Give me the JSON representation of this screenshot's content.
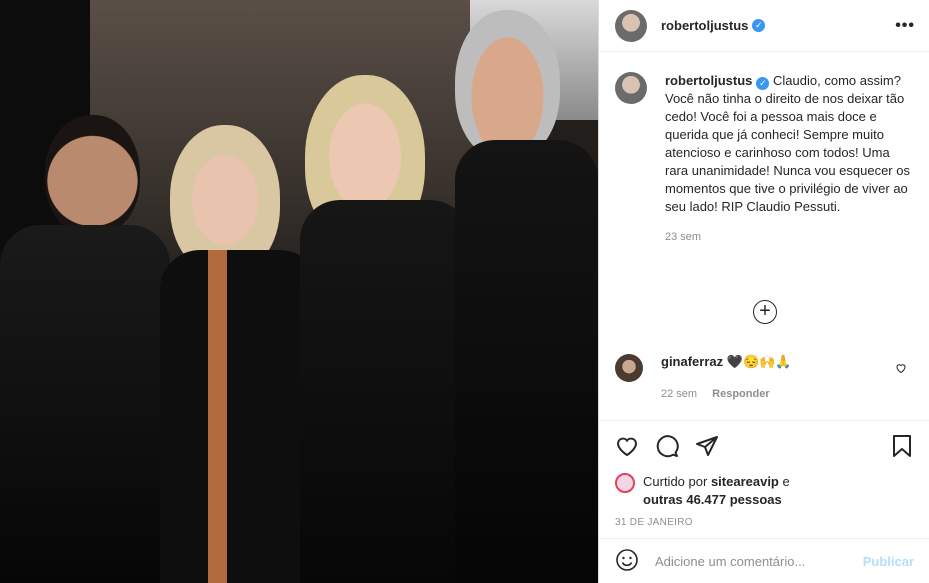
{
  "post": {
    "username": "robertoljustus",
    "more_icon": "more-dots-icon"
  },
  "caption": {
    "username": "robertoljustus",
    "text": "Claudio, como assim? Você não tinha o direito de nos deixar tão cedo! Você foi a pessoa mais doce e querida que já conheci! Sempre muito atencioso e carinhoso com todos! Uma rara unanimidade! Nunca vou esquecer os momentos que tive o privilégio de viver ao seu lado! RIP Claudio Pessuti.",
    "time": "23 sem"
  },
  "comment": {
    "username": "ginaferraz",
    "text": "🖤😔🙌🙏",
    "time": "22 sem",
    "reply_label": "Responder"
  },
  "likes": {
    "prefix": "Curtido por",
    "user": "sitеareavip",
    "middle": "e",
    "others": "outras 46.477 pessoas"
  },
  "date": "31 DE JANEIRO",
  "add_comment": {
    "placeholder": "Adicione um comentário...",
    "publish_label": "Publicar"
  }
}
